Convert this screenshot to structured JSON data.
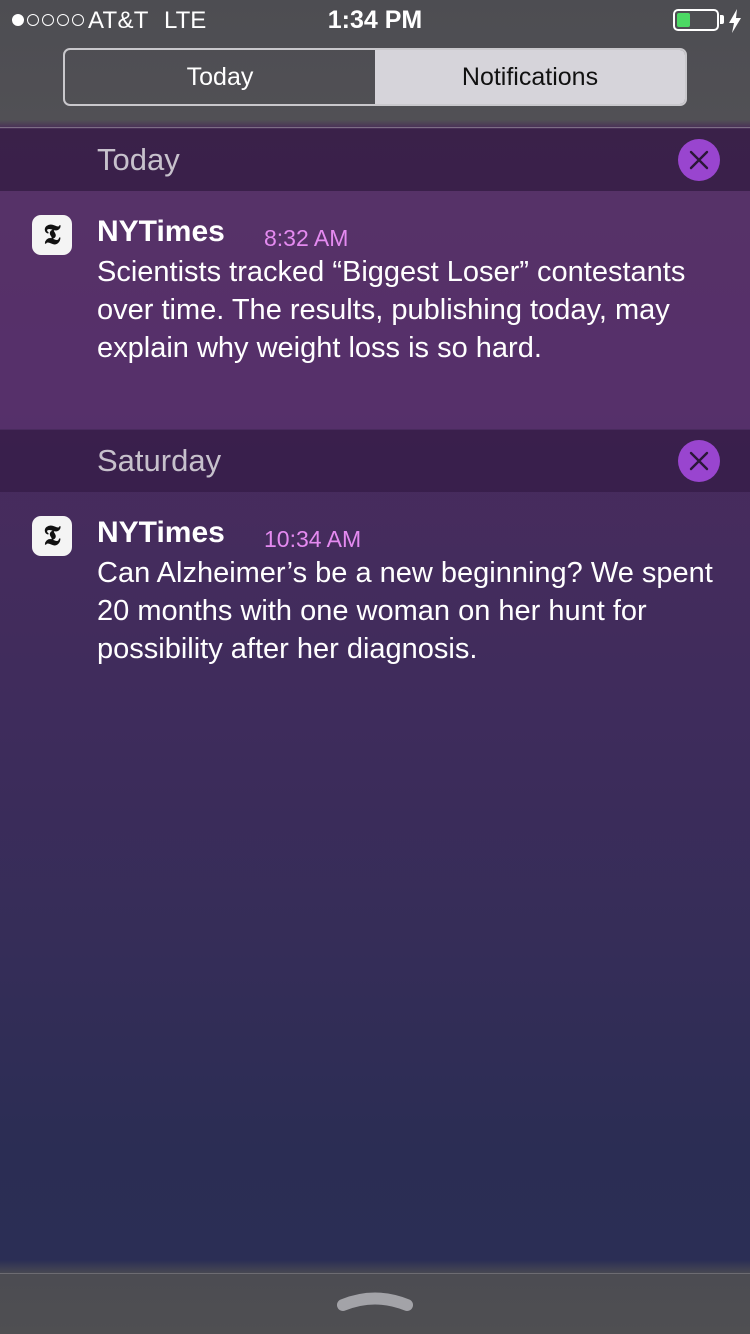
{
  "status_bar": {
    "signal_dots": [
      true,
      false,
      false,
      false,
      false
    ],
    "carrier": "AT&T",
    "network": "LTE",
    "time": "1:34 PM",
    "battery_level": 0.4,
    "battery_color": "#4cd964"
  },
  "tabs": [
    {
      "label": "Today",
      "selected": false
    },
    {
      "label": "Notifications",
      "selected": true
    }
  ],
  "sections": [
    {
      "title": "Today",
      "clear_icon": "close-icon",
      "notifications": [
        {
          "app": "NYTimes",
          "icon": "nytimes-app-icon",
          "icon_glyph": "𝕿",
          "time": "8:32 AM",
          "body": "Scientists tracked “Biggest Loser” contestants over time. The results, publishing today, may explain why weight loss is so hard."
        }
      ]
    },
    {
      "title": "Saturday",
      "clear_icon": "close-icon",
      "notifications": [
        {
          "app": "NYTimes",
          "icon": "nytimes-app-icon",
          "icon_glyph": "𝕿",
          "time": "10:34 AM",
          "body": "Can Alzheimer’s be a new beginning? We spent 20 months with one woman on her hunt for possibility after her diagnosis."
        }
      ]
    }
  ],
  "colors": {
    "accent_time": "#e48af0",
    "clear_button": "#9945cf"
  }
}
